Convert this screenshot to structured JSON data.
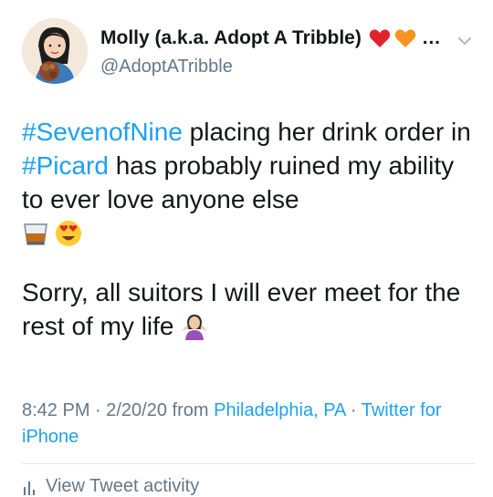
{
  "user": {
    "display_name": "Molly (a.k.a. Adopt A Tribble)",
    "name_trailing": "…",
    "handle": "@AdoptATribble"
  },
  "tweet": {
    "hashtag1": "#SevenofNine",
    "text1": " placing her drink order in ",
    "hashtag2": "#Picard",
    "text2": " has probably ruined my ability to ever love anyone else",
    "para2": "Sorry, all suitors I will ever meet for the rest of my life"
  },
  "meta": {
    "time_date": "8:42 PM · 2/20/20 from ",
    "location": "Philadelphia, PA",
    "separator": " · ",
    "source": "Twitter for iPhone"
  },
  "footer": {
    "activity_label": "View Tweet activity"
  },
  "icons": {
    "avatar": "avatar-illustration",
    "heart1": "red-heart-emoji",
    "heart2": "orange-heart-emoji",
    "menu": "chevron-down-icon",
    "drink": "tumbler-glass-emoji",
    "love": "heart-eyes-emoji",
    "shrug": "person-shrugging-emoji",
    "activity": "bar-chart-icon"
  },
  "colors": {
    "link": "#1da1f2",
    "secondary": "#657786",
    "text": "#14171a"
  }
}
